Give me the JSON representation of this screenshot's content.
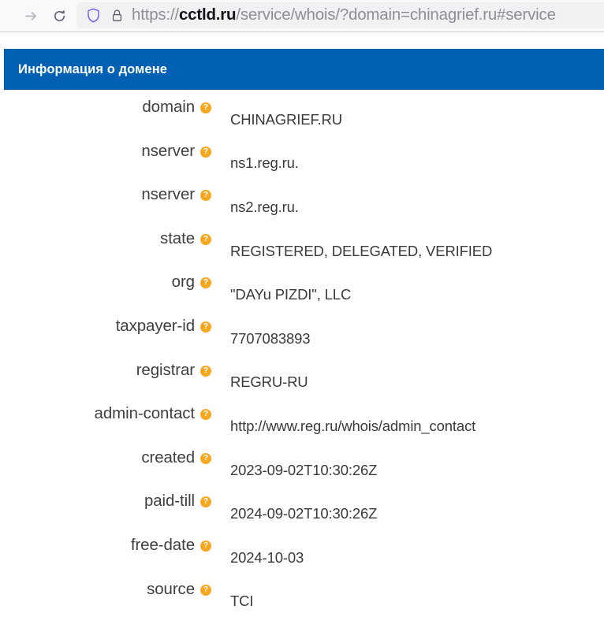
{
  "browser": {
    "forward_button_label": "Forward",
    "reload_button_label": "Reload",
    "shield_icon_label": "Enhanced Tracking Protection",
    "lock_icon_label": "Connection secure",
    "url_scheme": "https://",
    "url_domain": "cctld.ru",
    "url_path": "/service/whois/?domain=chinagrief.ru#service",
    "url_full": "https://cctld.ru/service/whois/?domain=chinagrief.ru#service"
  },
  "panel": {
    "title": "Информация о домене",
    "header_color": "#0060b3",
    "help_icon_color": "#f5a820"
  },
  "whois": {
    "rows": [
      {
        "label": "domain",
        "value": "CHINAGRIEF.RU"
      },
      {
        "label": "nserver",
        "value": "ns1.reg.ru."
      },
      {
        "label": "nserver",
        "value": "ns2.reg.ru."
      },
      {
        "label": "state",
        "value": "REGISTERED, DELEGATED, VERIFIED"
      },
      {
        "label": "org",
        "value": "\"DAYu PIZDI\", LLC"
      },
      {
        "label": "taxpayer-id",
        "value": "7707083893"
      },
      {
        "label": "registrar",
        "value": "REGRU-RU"
      },
      {
        "label": "admin-contact",
        "value": "http://www.reg.ru/whois/admin_contact"
      },
      {
        "label": "created",
        "value": "2023-09-02T10:30:26Z"
      },
      {
        "label": "paid-till",
        "value": "2024-09-02T10:30:26Z"
      },
      {
        "label": "free-date",
        "value": "2024-10-03"
      },
      {
        "label": "source",
        "value": "TCI"
      }
    ]
  }
}
